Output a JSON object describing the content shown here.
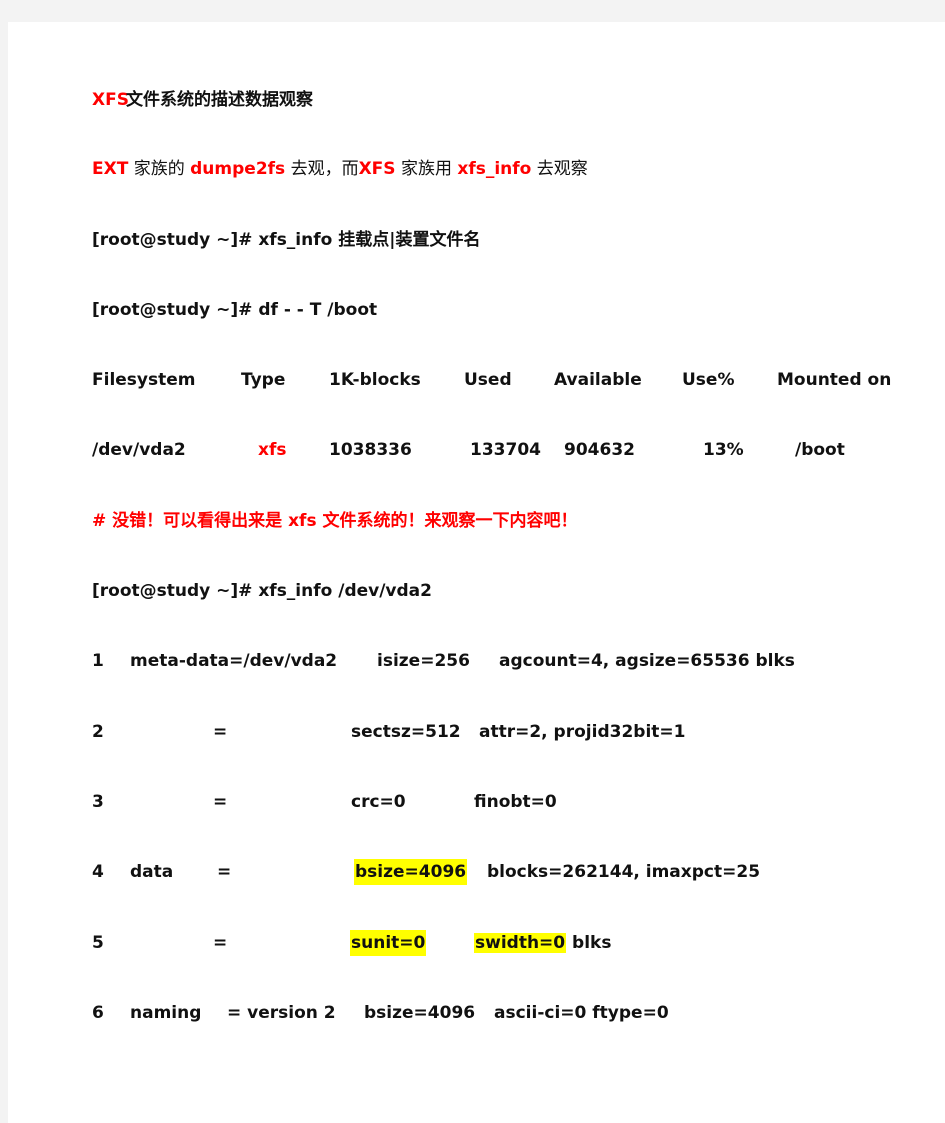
{
  "title": {
    "prefix": "XFS",
    "text": " 文件系统的描述数据观察"
  },
  "intro": {
    "p1": "EXT",
    "p2": " 家族的 ",
    "p3": "dumpe2fs",
    "p4": " 去观，而",
    "p5": "XFS",
    "p6": " 家族用 ",
    "p7": "xfs_info",
    "p8": " 去观察"
  },
  "cmd_usage": "[root@study  ~]#  xfs_info 挂载点|装置文件名",
  "cmd_df": "[root@study  ~]# df  -  - T /boot",
  "df_table": {
    "headers": [
      "Filesystem",
      "Type",
      "1K-blocks",
      "Used",
      "Available",
      "Use%",
      "Mounted  on"
    ],
    "rows": [
      [
        "/dev/vda2",
        "xfs",
        "1038336",
        "133704",
        "904632",
        "13%",
        "/boot"
      ]
    ]
  },
  "comment": "#  没错！可以看得出来是  xfs  文件系统的！来观察一下内容吧！",
  "cmd_xfs_info": "[root@study  ~]#  xfs_info  /dev/vda2",
  "xfs_info_lines": [
    {
      "num": "1",
      "section": "meta-data=/dev/vda2",
      "c3": "isize=256",
      "c4": "agcount=4,  agsize=65536  blks"
    },
    {
      "num": "2",
      "section": "=",
      "c3": "sectsz=512",
      "c4": "attr=2,  projid32bit=1"
    },
    {
      "num": "3",
      "section": "=",
      "c3": "crc=0",
      "c4": "finobt=0"
    },
    {
      "num": "4",
      "section": "data",
      "eq": "=",
      "c3": "bsize=4096",
      "c4": "blocks=262144,  imaxpct=25"
    },
    {
      "num": "5",
      "section": "=",
      "c3": "sunit=0",
      "c4": "swidth=0",
      "c5": "blks"
    },
    {
      "num": "6",
      "section": "naming",
      "eq": "=  version  2",
      "c3": "bsize=4096",
      "c4": "ascii-ci=0  ftype=0"
    }
  ],
  "colors": {
    "accent_red": "#ff0000",
    "highlight": "#ffff00",
    "text": "#111111"
  }
}
